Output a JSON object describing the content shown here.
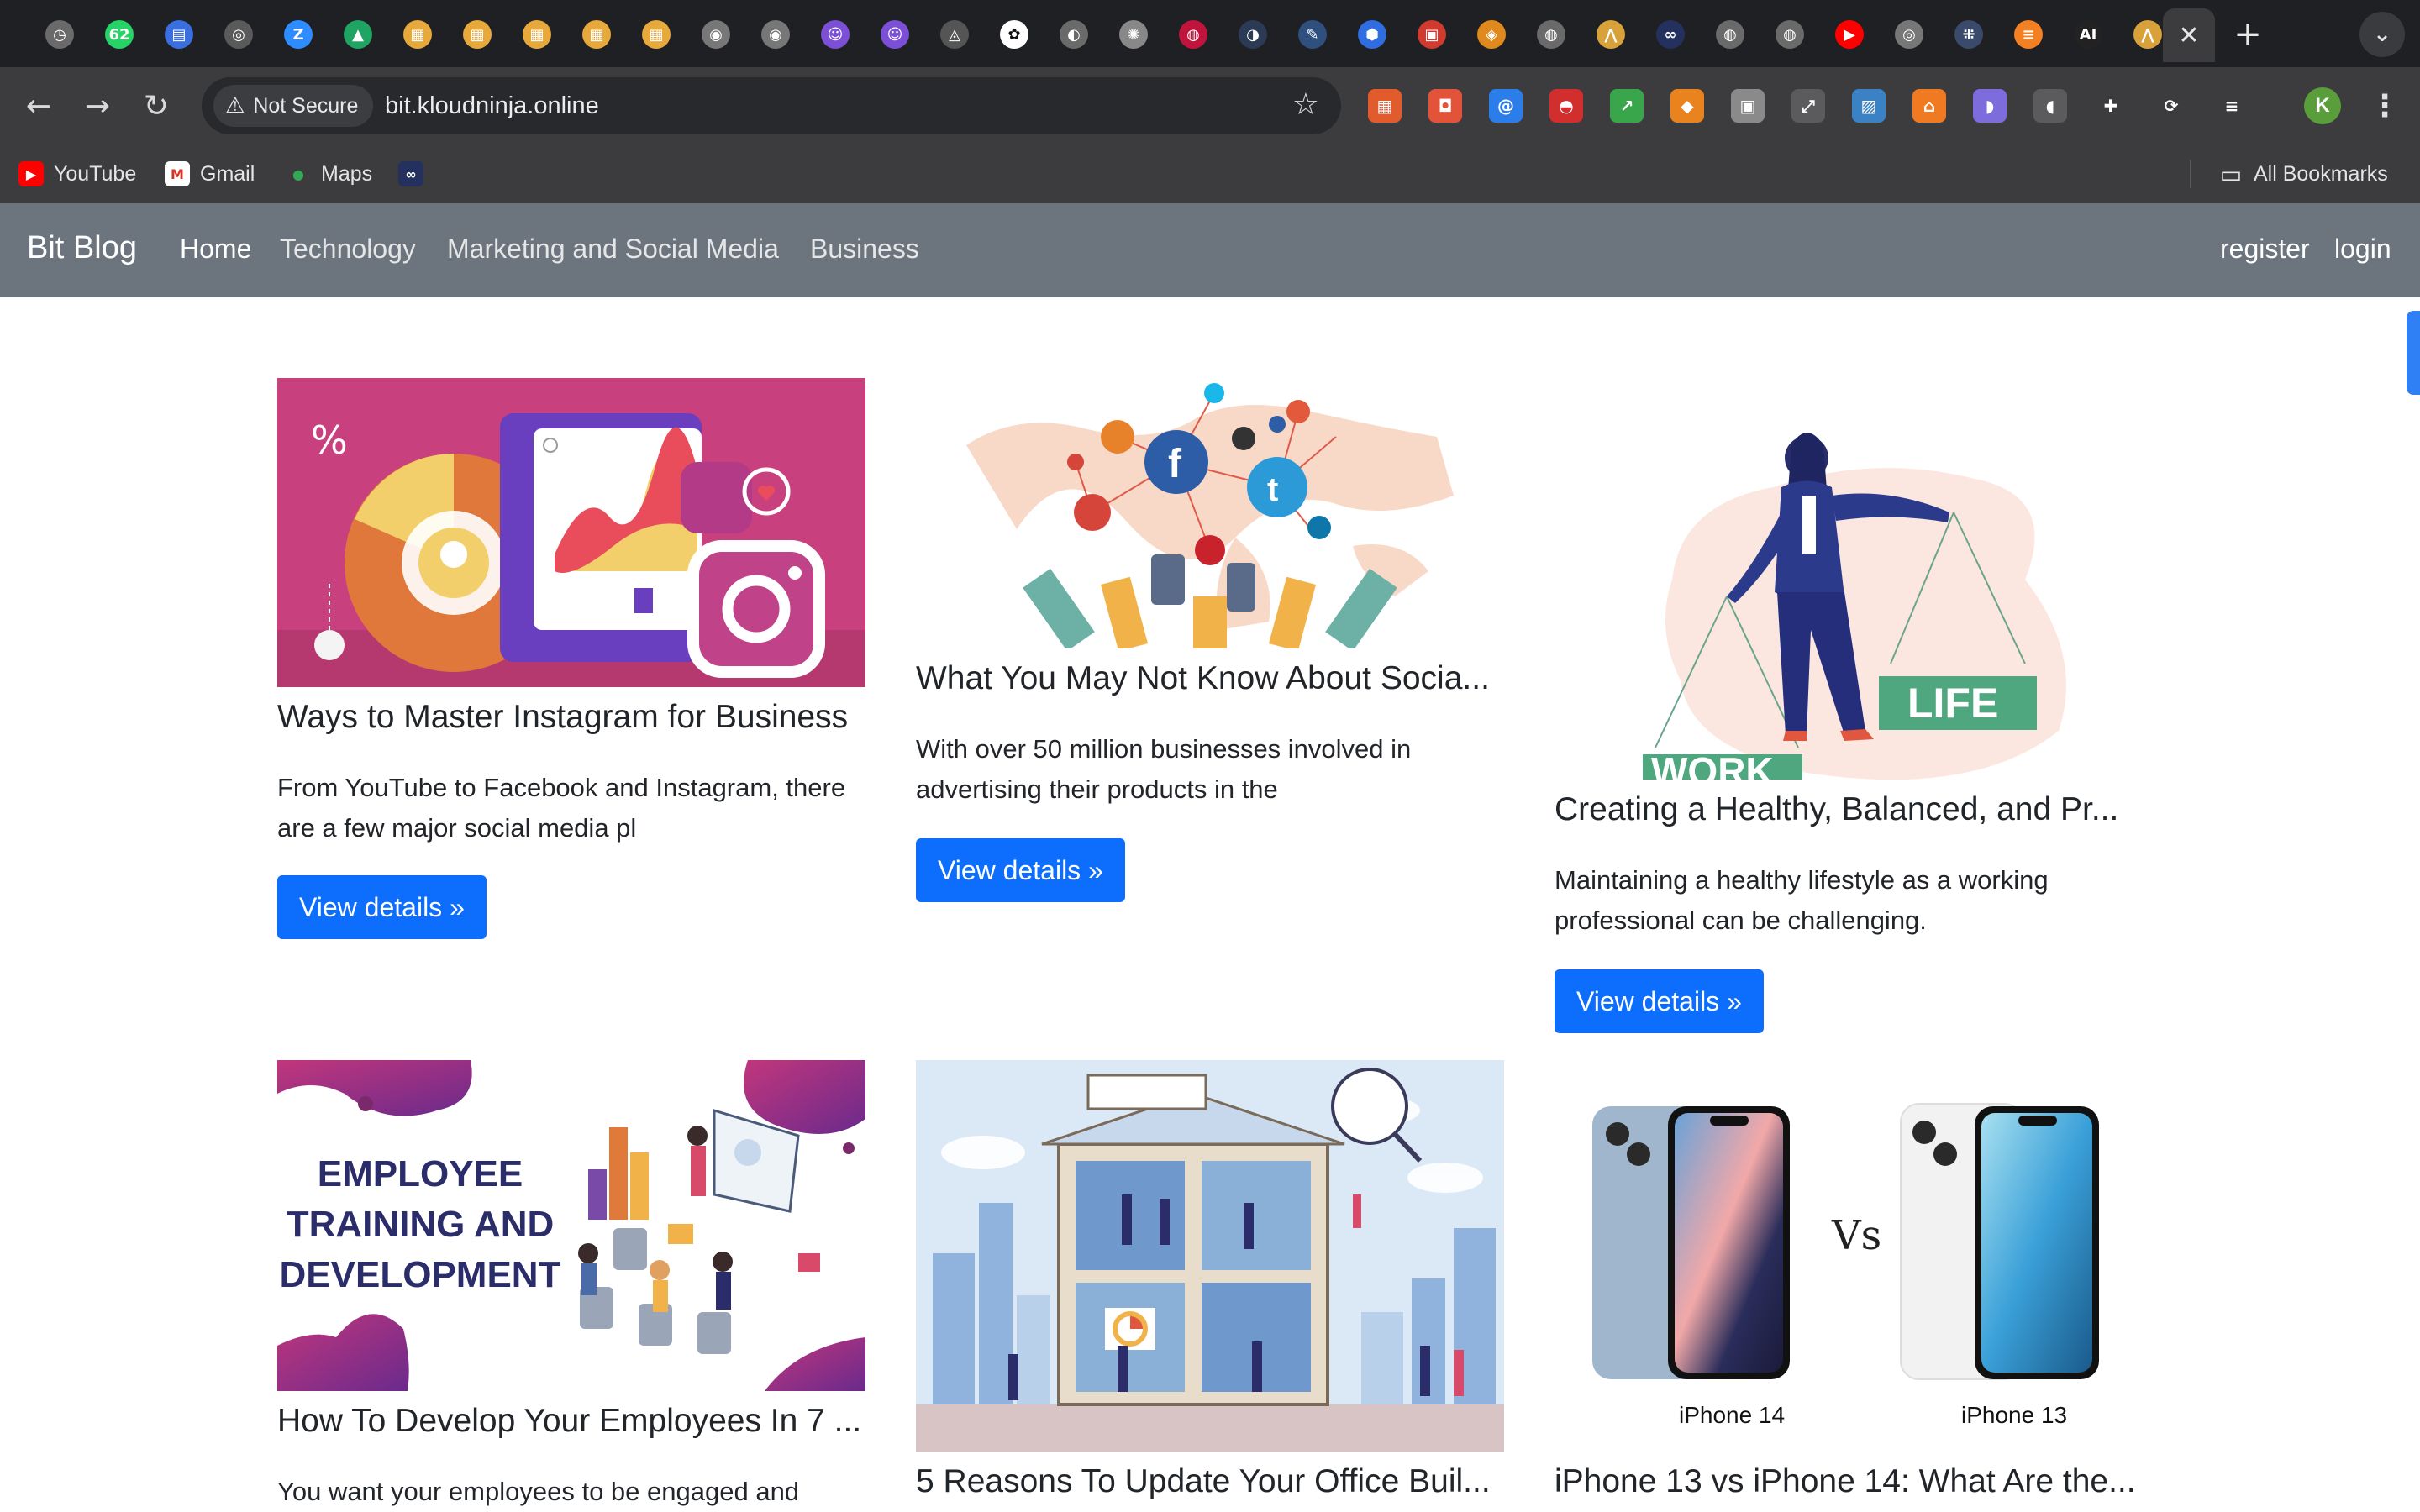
{
  "browser": {
    "tabs": [
      {
        "icon": "clock-icon",
        "color": "#6a6a6a",
        "glyph": "◷"
      },
      {
        "icon": "whatsapp-icon",
        "color": "#25d366",
        "glyph": "62"
      },
      {
        "icon": "google-docs-icon",
        "color": "#3a6fe0",
        "glyph": "▤"
      },
      {
        "icon": "globe-icon",
        "color": "#5a5a5a",
        "glyph": "◎"
      },
      {
        "icon": "zoom-icon",
        "color": "#2d8cff",
        "glyph": "Z"
      },
      {
        "icon": "google-drive-icon",
        "color": "#1fa463",
        "glyph": "▲"
      },
      {
        "icon": "package-icon",
        "color": "#e7a93c",
        "glyph": "▦"
      },
      {
        "icon": "package-icon",
        "color": "#e7a93c",
        "glyph": "▦"
      },
      {
        "icon": "package-icon",
        "color": "#e7a93c",
        "glyph": "▦"
      },
      {
        "icon": "package-icon",
        "color": "#e7a93c",
        "glyph": "▦"
      },
      {
        "icon": "package-icon",
        "color": "#e7a93c",
        "glyph": "▦"
      },
      {
        "icon": "target-icon",
        "color": "#777777",
        "glyph": "◉"
      },
      {
        "icon": "target-icon",
        "color": "#777777",
        "glyph": "◉"
      },
      {
        "icon": "bot-icon",
        "color": "#7b4fd6",
        "glyph": "☺"
      },
      {
        "icon": "bot-icon",
        "color": "#7b4fd6",
        "glyph": "☺"
      },
      {
        "icon": "drive-icon",
        "color": "#555555",
        "glyph": "◬"
      },
      {
        "icon": "openai-icon",
        "color": "#ffffff",
        "glyph": "✿"
      },
      {
        "icon": "compass-icon",
        "color": "#6a6a6a",
        "glyph": "◐"
      },
      {
        "icon": "chatgpt-icon",
        "color": "#888888",
        "glyph": "✺"
      },
      {
        "icon": "lg-icon",
        "color": "#c0143c",
        "glyph": "◍"
      },
      {
        "icon": "app-icon",
        "color": "#2b3a55",
        "glyph": "◑"
      },
      {
        "icon": "pen-icon",
        "color": "#2f4f7f",
        "glyph": "✎"
      },
      {
        "icon": "cube-icon",
        "color": "#2f6de1",
        "glyph": "⬢"
      },
      {
        "icon": "news-icon",
        "color": "#d03a2f",
        "glyph": "▣"
      },
      {
        "icon": "box-icon",
        "color": "#e08a1e",
        "glyph": "◈"
      },
      {
        "icon": "globe-icon",
        "color": "#6a6a6a",
        "glyph": "◍"
      },
      {
        "icon": "mountain-icon",
        "color": "#d9a13a",
        "glyph": "⋀"
      },
      {
        "icon": "link-icon",
        "color": "#24305e",
        "glyph": "∞"
      },
      {
        "icon": "globe-icon",
        "color": "#6a6a6a",
        "glyph": "◍"
      },
      {
        "icon": "globe-icon",
        "color": "#6a6a6a",
        "glyph": "◍"
      },
      {
        "icon": "youtube-icon",
        "color": "#ff0000",
        "glyph": "▶"
      },
      {
        "icon": "chrome-icon",
        "color": "#777777",
        "glyph": "◎"
      },
      {
        "icon": "grid-icon",
        "color": "#3a4a6a",
        "glyph": "⁜"
      },
      {
        "icon": "stackoverflow-icon",
        "color": "#f48024",
        "glyph": "≡"
      },
      {
        "icon": "ai-icon",
        "color": "#222222",
        "glyph": "AI"
      },
      {
        "icon": "mountain-icon",
        "color": "#d9a13a",
        "glyph": "⋀"
      }
    ],
    "active_tab_close": "✕",
    "new_tab": "+",
    "tab_search": "⌄",
    "back": "←",
    "forward": "→",
    "reload": "↻",
    "security_icon": "⚠",
    "security_label": "Not Secure",
    "url": "bit.kloudninja.online",
    "bookmark_star": "☆",
    "extensions": [
      {
        "icon": "calendar-ext-icon",
        "color": "#e25b2d",
        "glyph": "▦"
      },
      {
        "icon": "camera-ext-icon",
        "color": "#e2533a",
        "glyph": "◘"
      },
      {
        "icon": "at-ext-icon",
        "color": "#2b7de9",
        "glyph": "@"
      },
      {
        "icon": "pokeball-ext-icon",
        "color": "#d22e2e",
        "glyph": "◓"
      },
      {
        "icon": "chart-ext-icon",
        "color": "#3aa64c",
        "glyph": "↗"
      },
      {
        "icon": "metamask-ext-icon",
        "color": "#e8831d",
        "glyph": "◆"
      },
      {
        "icon": "lock-ext-icon",
        "color": "#8a8a8a",
        "glyph": "▣"
      },
      {
        "icon": "expand-ext-icon",
        "color": "#5b5b5e",
        "glyph": "⤢"
      },
      {
        "icon": "image-ext-icon",
        "color": "#3b82c4",
        "glyph": "▨"
      },
      {
        "icon": "home-ext-icon",
        "color": "#f07a22",
        "glyph": "⌂"
      },
      {
        "icon": "ghost-ext-icon",
        "color": "#7c6cdc",
        "glyph": "◗"
      },
      {
        "icon": "mouse-ext-icon",
        "color": "#5b5b5e",
        "glyph": "◖"
      },
      {
        "icon": "puzzle-ext-icon",
        "color": "#3c3c3f",
        "glyph": "✚"
      },
      {
        "icon": "speed-ext-icon",
        "color": "#3c3c3f",
        "glyph": "⟳"
      },
      {
        "icon": "playlist-ext-icon",
        "color": "#3c3c3f",
        "glyph": "≡"
      }
    ],
    "profile_initial": "K",
    "menu": "⋮"
  },
  "bookmarks": {
    "items": [
      {
        "label": "YouTube",
        "icon": "youtube-icon",
        "color": "#ff0000",
        "glyph": "▶"
      },
      {
        "label": "Gmail",
        "icon": "gmail-icon",
        "color": "#d93025",
        "glyph": "M"
      },
      {
        "label": "Maps",
        "icon": "maps-pin-icon",
        "color": "#34a853",
        "glyph": "●"
      },
      {
        "label": "",
        "icon": "link-icon",
        "color": "#24305e",
        "glyph": "∞"
      }
    ],
    "all_bookmarks": "All Bookmarks",
    "folder_glyph": "▭"
  },
  "site": {
    "brand": "Bit Blog",
    "nav": [
      "Home",
      "Technology",
      "Marketing and Social Media",
      "Business"
    ],
    "register": "register",
    "login": "login",
    "navbar_color": "#6c757d",
    "button_color": "#0d6efd"
  },
  "cards": [
    {
      "title": "Ways to Master Instagram for Business",
      "excerpt": "From YouTube to Facebook and Instagram, there are a few major social media pl",
      "button": "View details »"
    },
    {
      "title": "What You May Not Know About Socia...",
      "excerpt": "With over 50 million businesses involved in advertising their products in the",
      "button": "View details »"
    },
    {
      "title": "Creating a Healthy, Balanced, and Pr...",
      "excerpt": "Maintaining a healthy lifestyle as a working professional can be challenging.",
      "button": "View details »",
      "image_text": {
        "life": "LIFE",
        "work": "WORK"
      }
    },
    {
      "title": "How To Develop Your Employees In 7 ...",
      "excerpt": "You want your employees to be engaged and",
      "image_text": {
        "line1": "EMPLOYEE",
        "line2": "TRAINING AND",
        "line3": "DEVELOPMENT"
      }
    },
    {
      "title": "5 Reasons To Update Your Office Buil..."
    },
    {
      "title": "iPhone 13 vs iPhone 14: What Are the...",
      "image_text": {
        "left": "iPhone 14",
        "vs": "Vs",
        "right": "iPhone 13"
      }
    }
  ]
}
